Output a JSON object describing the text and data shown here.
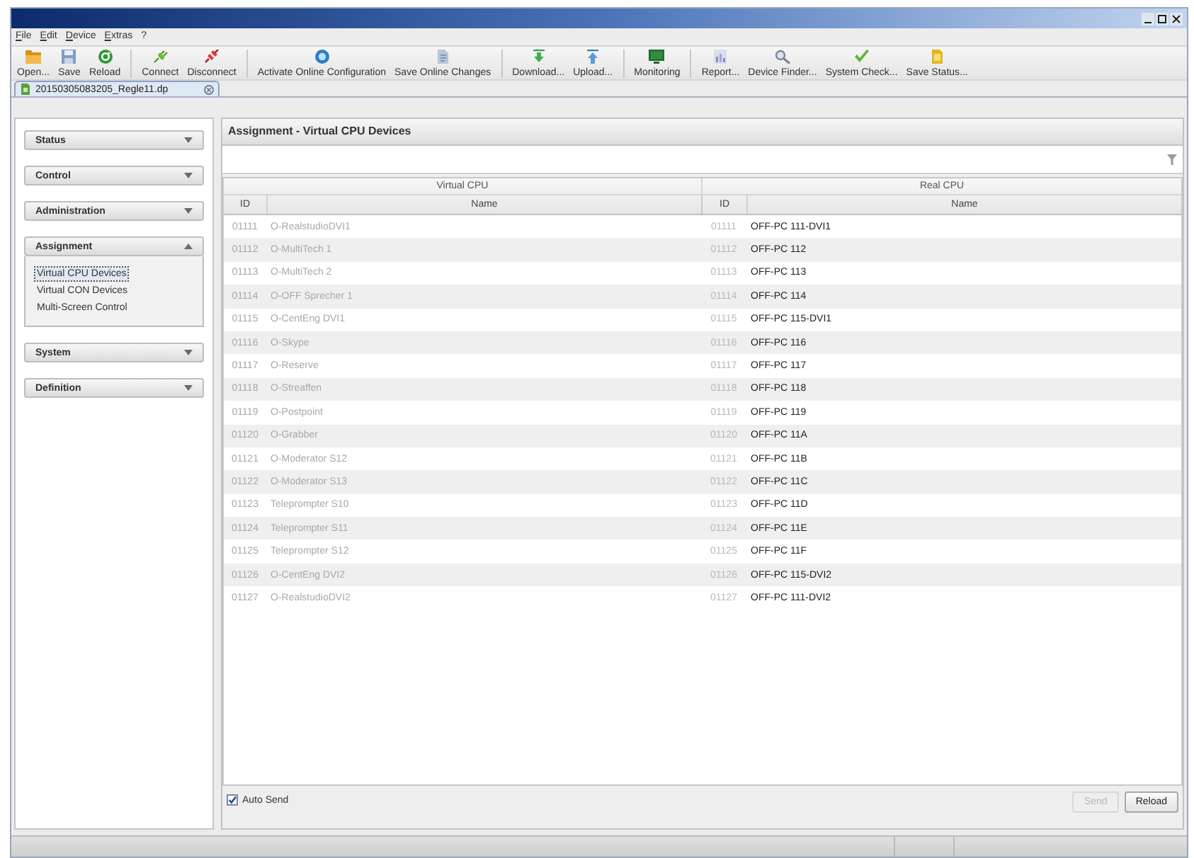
{
  "menu": [
    "File",
    "Edit",
    "Device",
    "Extras",
    "?"
  ],
  "toolbar": {
    "groups": [
      [
        {
          "kind": "open",
          "label": "Open..."
        },
        {
          "kind": "save",
          "label": "Save"
        },
        {
          "kind": "reload",
          "label": "Reload"
        }
      ],
      [
        {
          "kind": "connect",
          "label": "Connect"
        },
        {
          "kind": "disconnect",
          "label": "Disconnect"
        }
      ],
      [
        {
          "kind": "activate",
          "label": "Activate Online Configuration"
        },
        {
          "kind": "save_online",
          "label": "Save Online Changes"
        }
      ],
      [
        {
          "kind": "download",
          "label": "Download..."
        },
        {
          "kind": "upload",
          "label": "Upload..."
        }
      ],
      [
        {
          "kind": "monitoring",
          "label": "Monitoring"
        }
      ],
      [
        {
          "kind": "report",
          "label": "Report..."
        },
        {
          "kind": "finder",
          "label": "Device Finder..."
        },
        {
          "kind": "check",
          "label": "System Check..."
        },
        {
          "kind": "save_status",
          "label": "Save Status..."
        }
      ]
    ]
  },
  "document_tabs": [
    {
      "label": "20150305083205_Regle11.dp",
      "selected": true
    }
  ],
  "sidebar": {
    "sections": [
      {
        "label": "Status",
        "expanded": false
      },
      {
        "label": "Control",
        "expanded": false
      },
      {
        "label": "Administration",
        "expanded": false
      },
      {
        "label": "Assignment",
        "expanded": true,
        "items": [
          {
            "label": "Virtual CPU Devices",
            "selected": true
          },
          {
            "label": "Virtual CON Devices",
            "selected": false
          },
          {
            "label": "Multi-Screen Control",
            "selected": false
          }
        ]
      },
      {
        "label": "System",
        "expanded": false
      },
      {
        "label": "Definition",
        "expanded": false
      }
    ]
  },
  "panel": {
    "title": "Assignment - Virtual CPU Devices",
    "table": {
      "groups": [
        {
          "label": "Virtual CPU",
          "columns": [
            "ID",
            "Name"
          ]
        },
        {
          "label": "Real CPU",
          "columns": [
            "ID",
            "Name"
          ]
        }
      ],
      "rows": [
        [
          "01111",
          "O-RealstudioDVI1",
          "01111",
          "OFF-PC 111-DVI1"
        ],
        [
          "01112",
          "O-MultiTech 1",
          "01112",
          "OFF-PC 112"
        ],
        [
          "01113",
          "O-MultiTech 2",
          "01113",
          "OFF-PC 113"
        ],
        [
          "01114",
          "O-OFF Sprecher 1",
          "01114",
          "OFF-PC 114"
        ],
        [
          "01115",
          "O-CentEng DVI1",
          "01115",
          "OFF-PC 115-DVI1"
        ],
        [
          "01116",
          "O-Skype",
          "01116",
          "OFF-PC 116"
        ],
        [
          "01117",
          "O-Reserve",
          "01117",
          "OFF-PC 117"
        ],
        [
          "01118",
          "O-Streaffen",
          "01118",
          "OFF-PC 118"
        ],
        [
          "01119",
          "O-Postpoint",
          "01119",
          "OFF-PC 119"
        ],
        [
          "01120",
          "O-Grabber",
          "01120",
          "OFF-PC 11A"
        ],
        [
          "01121",
          "O-Moderator S12",
          "01121",
          "OFF-PC 11B"
        ],
        [
          "01122",
          "O-Moderator S13",
          "01122",
          "OFF-PC 11C"
        ],
        [
          "01123",
          "Teleprompter S10",
          "01123",
          "OFF-PC 11D"
        ],
        [
          "01124",
          "Teleprompter S11",
          "01124",
          "OFF-PC 11E"
        ],
        [
          "01125",
          "Teleprompter S12",
          "01125",
          "OFF-PC 11F"
        ],
        [
          "01126",
          "O-CentEng DVI2",
          "01126",
          "OFF-PC 115-DVI2"
        ],
        [
          "01127",
          "O-RealstudioDVI2",
          "01127",
          "OFF-PC 111-DVI2"
        ]
      ]
    },
    "auto_send": {
      "label": "Auto Send",
      "checked": true
    },
    "buttons": [
      {
        "label": "Send",
        "disabled": true
      },
      {
        "label": "Reload",
        "disabled": false
      }
    ]
  }
}
